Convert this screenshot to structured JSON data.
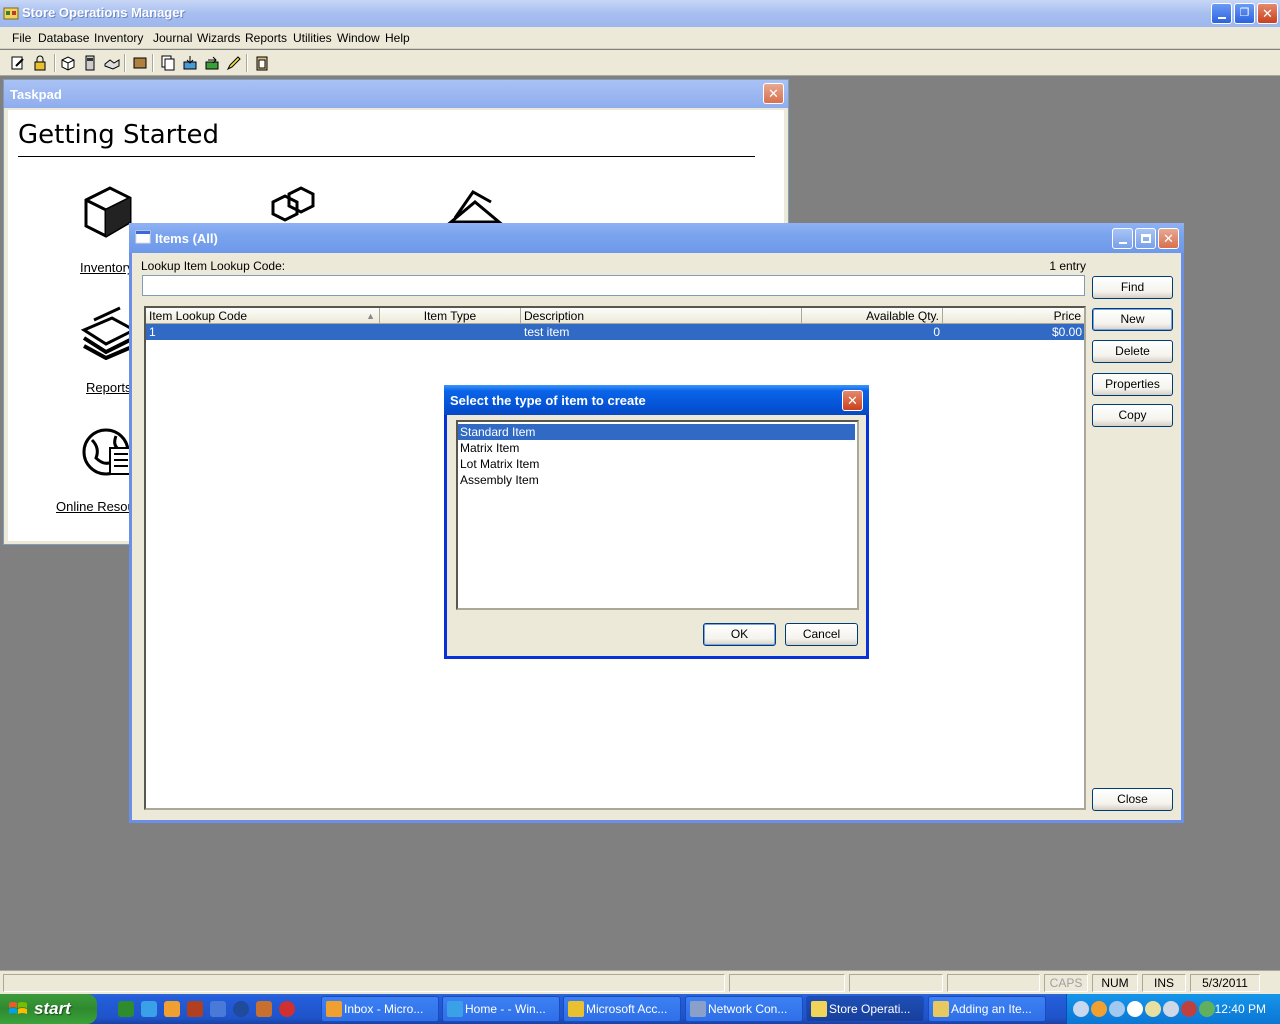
{
  "app": {
    "title": "Store Operations Manager",
    "menu": [
      "File",
      "Database",
      "Inventory",
      "Journal",
      "Wizards",
      "Reports",
      "Utilities",
      "Window",
      "Help"
    ]
  },
  "taskpad": {
    "title": "Taskpad",
    "heading": "Getting Started",
    "links": [
      "Inventory",
      "Reports",
      "Online Resources"
    ]
  },
  "items_window": {
    "title": "Items (All)",
    "lookup_label": "Lookup Item Lookup Code:",
    "entry_count": "1 entry",
    "lookup_value": "",
    "columns": [
      "Item Lookup Code",
      "Item Type",
      "Description",
      "Available Qty.",
      "Price"
    ],
    "rows": [
      {
        "code": "1",
        "type": "",
        "description": "test item",
        "qty": "0",
        "price": "$0.00"
      }
    ],
    "buttons": {
      "find": "Find",
      "new": "New",
      "delete": "Delete",
      "properties": "Properties",
      "copy": "Copy",
      "close": "Close"
    }
  },
  "dialog": {
    "title": "Select the type of item to create",
    "options": [
      "Standard Item",
      "Matrix Item",
      "Lot Matrix Item",
      "Assembly Item"
    ],
    "selected_index": 0,
    "ok": "OK",
    "cancel": "Cancel"
  },
  "statusbar": {
    "caps": "CAPS",
    "num": "NUM",
    "ins": "INS",
    "date": "5/3/2011"
  },
  "taskbar": {
    "start": "start",
    "tasks": [
      "Inbox - Micro...",
      "Home - - Win...",
      "Microsoft Acc...",
      "Network Con...",
      "Store Operati...",
      "Adding an Ite..."
    ],
    "active_task_index": 4,
    "clock": "12:40 PM"
  },
  "colors": {
    "selection": "#316ac5",
    "xp_blue": "#0553d6",
    "start_green": "#3c9a3c"
  }
}
